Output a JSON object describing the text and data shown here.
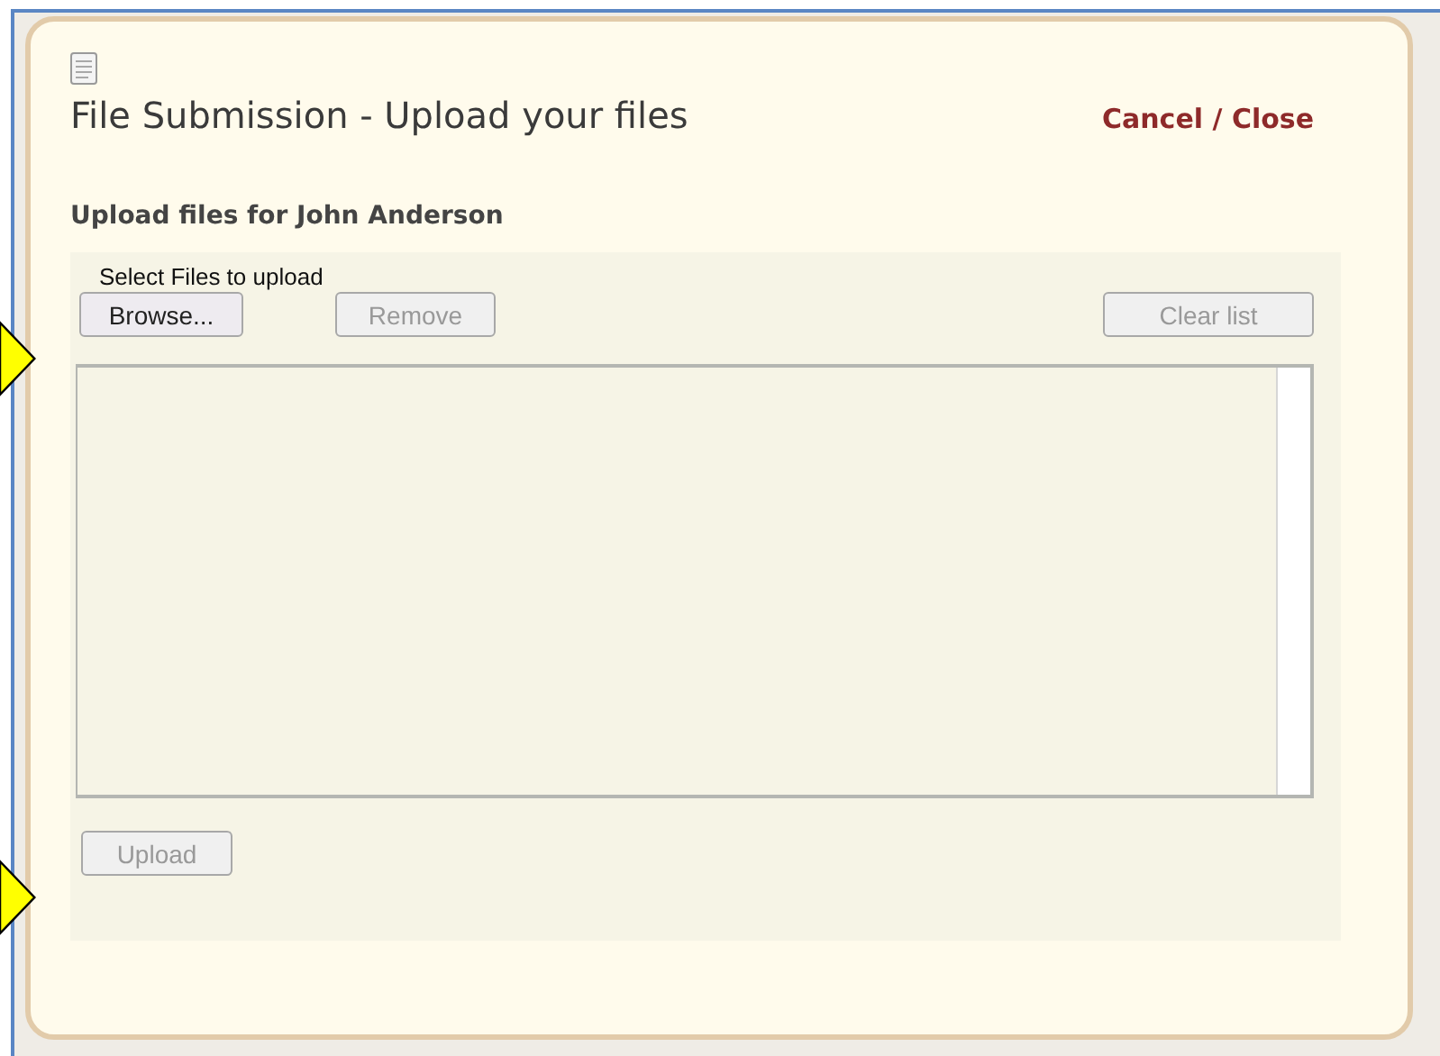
{
  "dialog": {
    "title": "File Submission - Upload your files",
    "close_link": "Cancel / Close",
    "heading": "Upload files for John Anderson"
  },
  "uploader": {
    "label": "Select Files to upload",
    "buttons": [
      {
        "label": "Browse...",
        "disabled": false
      },
      {
        "label": "Remove",
        "disabled": true
      },
      {
        "label": "Clear list",
        "disabled": true
      }
    ],
    "upload_button": {
      "label": "Upload",
      "disabled": true
    }
  }
}
